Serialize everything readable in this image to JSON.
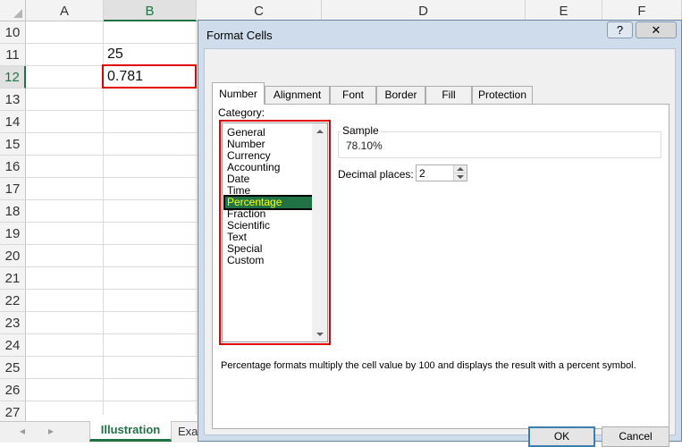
{
  "sheet": {
    "columns": [
      "A",
      "B",
      "C",
      "D",
      "E",
      "F"
    ],
    "selected_column": "B",
    "rows": [
      "10",
      "11",
      "12",
      "13",
      "14",
      "15",
      "16",
      "17",
      "18",
      "19",
      "20",
      "21",
      "22",
      "23",
      "24",
      "25",
      "26",
      "27"
    ],
    "selected_row": "12",
    "cells": {
      "B11": "25",
      "B12": "0.781"
    },
    "tabs": [
      "Illustration",
      "Exa"
    ],
    "active_tab": "Illustration",
    "nav_prev": "◂",
    "nav_next": "▸"
  },
  "dialog": {
    "title": "Format Cells",
    "help_label": "?",
    "close_label": "✕",
    "tabs": [
      "Number",
      "Alignment",
      "Font",
      "Border",
      "Fill",
      "Protection"
    ],
    "active_tab": "Number",
    "category_label": "Category:",
    "categories": [
      "General",
      "Number",
      "Currency",
      "Accounting",
      "Date",
      "Time",
      "Percentage",
      "Fraction",
      "Scientific",
      "Text",
      "Special",
      "Custom"
    ],
    "selected_category": "Percentage",
    "sample_label": "Sample",
    "sample_value": "78.10%",
    "decimal_label": "Decimal places:",
    "decimal_value": "2",
    "description": "Percentage formats multiply the cell value by 100 and displays the result with a percent symbol.",
    "ok_label": "OK",
    "cancel_label": "Cancel"
  },
  "colors": {
    "excel_green": "#217346",
    "highlight_red": "#e00000",
    "selected_text": "#ffff00"
  }
}
